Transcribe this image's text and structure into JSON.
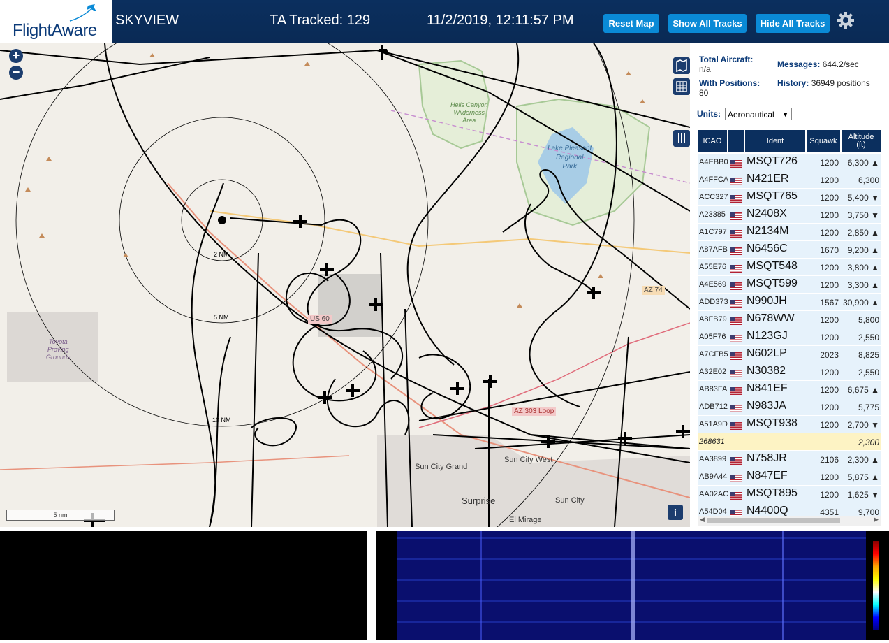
{
  "header": {
    "logo": "FlightAware",
    "app_title": "SKYVIEW",
    "tracked": "TA Tracked: 129",
    "datetime": "11/2/2019, 12:11:57 PM",
    "buttons": {
      "reset": "Reset Map",
      "show": "Show All Tracks",
      "hide": "Hide All Tracks"
    },
    "settings_icon": "gear-icon"
  },
  "map": {
    "labels": {
      "hells": "Hells Canyon",
      "wild": "Wilderness",
      "area": "Area",
      "lake1": "Lake Pleasant",
      "lake2": "Regional",
      "lake3": "Park",
      "toyota1": "Toyota",
      "toyota2": "Proving",
      "toyota3": "Grounds",
      "sun_city_grand": "Sun City Grand",
      "sun_city_west": "Sun City West",
      "surprise": "Surprise",
      "sun_city": "Sun City",
      "el_mirage": "El Mirage",
      "loop": "AZ 303 Loop",
      "az74": "AZ 74",
      "us60": "US 60"
    },
    "rings": [
      "2 NM",
      "5 NM",
      "10 NM"
    ],
    "scale": "5 nm",
    "info_button": "i",
    "colors": {
      "background": "#f2efe9",
      "track": "#000000",
      "road": "#e8927c",
      "water": "#a8cde6"
    }
  },
  "stats": {
    "total_label": "Total Aircraft:",
    "total_value": "n/a",
    "positions_label": "With Positions:",
    "positions_value": "80",
    "messages_label": "Messages:",
    "messages_value": "644.2/sec",
    "history_label": "History:",
    "history_value": "36949 positions"
  },
  "units": {
    "label": "Units:",
    "selected": "Aeronautical"
  },
  "table": {
    "headers": {
      "icao": "ICAO",
      "ident": "Ident",
      "squawk": "Squawk",
      "alt1": "Altitude",
      "alt2": "(ft)"
    },
    "rows": [
      {
        "icao": "A4EBB0",
        "ident": "MSQT726",
        "squawk": "1200",
        "alt": "6,300 ▲"
      },
      {
        "icao": "A4FFCA",
        "ident": "N421ER",
        "squawk": "1200",
        "alt": "6,300"
      },
      {
        "icao": "ACC327",
        "ident": "MSQT765",
        "squawk": "1200",
        "alt": "5,400 ▼"
      },
      {
        "icao": "A23385",
        "ident": "N2408X",
        "squawk": "1200",
        "alt": "3,750 ▼"
      },
      {
        "icao": "A1C797",
        "ident": "N2134M",
        "squawk": "1200",
        "alt": "2,850 ▲"
      },
      {
        "icao": "A87AFB",
        "ident": "N6456C",
        "squawk": "1670",
        "alt": "9,200 ▲"
      },
      {
        "icao": "A55E76",
        "ident": "MSQT548",
        "squawk": "1200",
        "alt": "3,800 ▲"
      },
      {
        "icao": "A4E569",
        "ident": "MSQT599",
        "squawk": "1200",
        "alt": "3,300 ▲"
      },
      {
        "icao": "ADD373",
        "ident": "N990JH",
        "squawk": "1567",
        "alt": "30,900 ▲"
      },
      {
        "icao": "A8FB79",
        "ident": "N678WW",
        "squawk": "1200",
        "alt": "5,800"
      },
      {
        "icao": "A05F76",
        "ident": "N123GJ",
        "squawk": "1200",
        "alt": "2,550"
      },
      {
        "icao": "A7CFB5",
        "ident": "N602LP",
        "squawk": "2023",
        "alt": "8,825"
      },
      {
        "icao": "A32E02",
        "ident": "N30382",
        "squawk": "1200",
        "alt": "2,550"
      },
      {
        "icao": "AB83FA",
        "ident": "N841EF",
        "squawk": "1200",
        "alt": "6,675 ▲"
      },
      {
        "icao": "ADB712",
        "ident": "N983JA",
        "squawk": "1200",
        "alt": "5,775"
      },
      {
        "icao": "A51A9D",
        "ident": "MSQT938",
        "squawk": "1200",
        "alt": "2,700 ▼"
      },
      {
        "icao": "268631",
        "ident": "",
        "squawk": "",
        "alt": "2,300"
      },
      {
        "icao": "AA3899",
        "ident": "N758JR",
        "squawk": "2106",
        "alt": "2,300 ▲"
      },
      {
        "icao": "AB9A44",
        "ident": "N847EF",
        "squawk": "1200",
        "alt": "5,875 ▲"
      },
      {
        "icao": "AA02AC",
        "ident": "MSQT895",
        "squawk": "1200",
        "alt": "1,625 ▼"
      },
      {
        "icao": "A54D04",
        "ident": "N4400Q",
        "squawk": "4351",
        "alt": "9,700"
      }
    ]
  }
}
